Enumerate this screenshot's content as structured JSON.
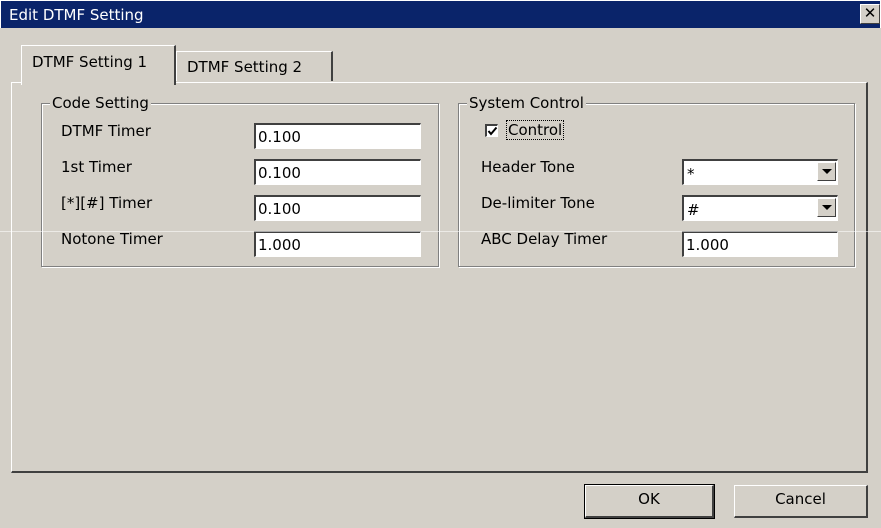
{
  "window": {
    "title": "Edit DTMF Setting",
    "close_glyph": "✕"
  },
  "tabs": [
    {
      "label": "DTMF Setting 1",
      "active": true
    },
    {
      "label": "DTMF Setting 2",
      "active": false
    }
  ],
  "code_setting": {
    "title": "Code Setting",
    "fields": [
      {
        "label": "DTMF Timer",
        "value": "0.100"
      },
      {
        "label": "1st Timer",
        "value": "0.100"
      },
      {
        "label": "[*][#] Timer",
        "value": "0.100"
      },
      {
        "label": "Notone Timer",
        "value": "1.000"
      }
    ]
  },
  "system_control": {
    "title": "System Control",
    "control_checkbox": {
      "label": "Control",
      "checked": true
    },
    "header_tone": {
      "label": "Header Tone",
      "value": "*"
    },
    "delimiter_tone": {
      "label": "De-limiter Tone",
      "value": "#"
    },
    "abc_delay_timer": {
      "label": "ABC Delay Timer",
      "value": "1.000"
    }
  },
  "buttons": {
    "ok": "OK",
    "cancel": "Cancel"
  },
  "icons": {
    "close": "close-icon",
    "dropdown": "chevron-down-icon",
    "check": "checkmark-icon"
  },
  "colors": {
    "titlebar": "#0a246a",
    "face": "#d4d0c8"
  }
}
